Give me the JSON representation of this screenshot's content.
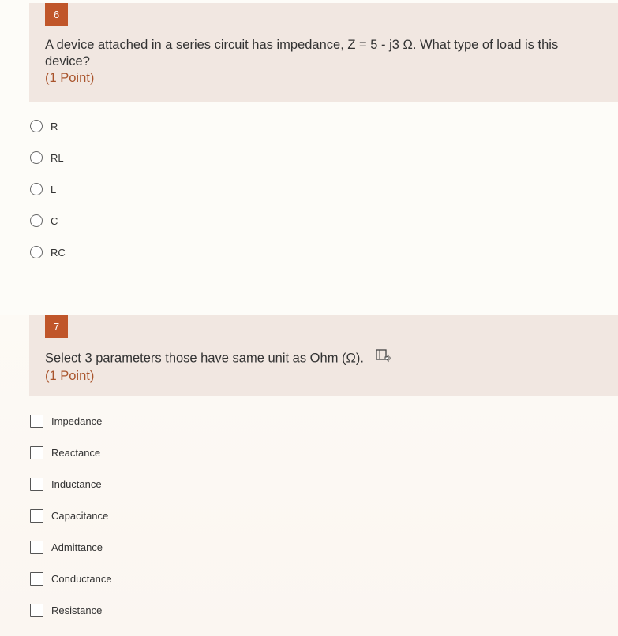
{
  "questions": [
    {
      "number": "6",
      "text": "A device attached in a series circuit has impedance, Z = 5 - j3 Ω. What type of load is this device?",
      "points": "(1 Point)",
      "input_type": "radio",
      "options": [
        "R",
        "RL",
        "L",
        "C",
        "RC"
      ]
    },
    {
      "number": "7",
      "text": "Select 3 parameters those have same unit as Ohm (Ω).",
      "points": "(1 Point)",
      "input_type": "checkbox",
      "read_aloud_icon": "immersive-reader-icon",
      "options": [
        "Impedance",
        "Reactance",
        "Inductance",
        "Capacitance",
        "Admittance",
        "Conductance",
        "Resistance"
      ]
    }
  ],
  "colors": {
    "accent": "#c0562a",
    "points_text": "#a9542c",
    "header_background": "#f1e7e1"
  }
}
